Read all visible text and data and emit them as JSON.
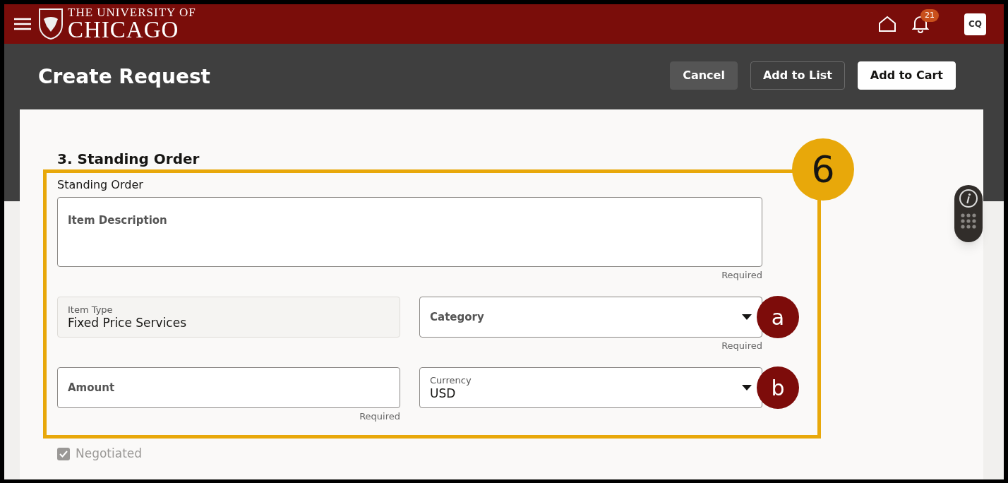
{
  "header": {
    "logo_line1": "THE UNIVERSITY OF",
    "logo_line2": "CHICAGO",
    "notifications_badge": "21",
    "avatar": "CQ"
  },
  "page_title": "Create Request",
  "buttons": [
    {
      "label": "Cancel",
      "kind": "subtle"
    },
    {
      "label": "Add to List",
      "kind": "outline"
    },
    {
      "label": "Add to Cart",
      "kind": "primary"
    }
  ],
  "section_title": "3. Standing Order",
  "group_label": "Standing Order",
  "description": {
    "label": "Item Description",
    "hint": "Required"
  },
  "rows": [
    [
      {
        "kind": "readonly",
        "label": "Item Type",
        "value": "Fixed Price Services"
      },
      {
        "kind": "select",
        "label": "Category",
        "hint": "Required",
        "callout": "a"
      }
    ],
    [
      {
        "kind": "input",
        "label": "Amount",
        "hint": "Required"
      },
      {
        "kind": "select",
        "label": "Currency",
        "value": "USD",
        "callout": "b"
      }
    ]
  ],
  "negotiated": {
    "label": "Negotiated",
    "checked": true,
    "disabled": true
  },
  "callout_number": "6"
}
